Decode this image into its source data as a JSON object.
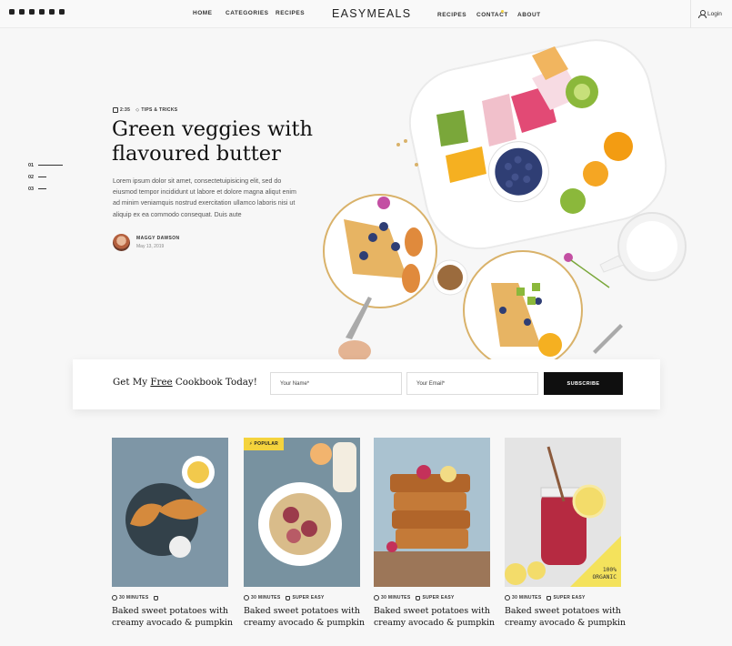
{
  "header": {
    "social_icons": [
      "instagram-icon",
      "twitter-icon",
      "facebook-icon",
      "pinterest-icon",
      "rss-icon",
      "youtube-icon"
    ],
    "nav_left": [
      "HOME",
      "CATEGORIES",
      "RECIPES"
    ],
    "brand": "EASYMEALS",
    "nav_right": [
      "RECIPES",
      "CONTACT",
      "ABOUT"
    ],
    "login": "Login"
  },
  "slides": [
    "01",
    "02",
    "03"
  ],
  "hero": {
    "time": "2:35",
    "category": "TIPS & TRICKS",
    "title": "Green veggies with flavoured butter",
    "description": "Lorem ipsum dolor sit amet, consectetuipisicing elit, sed do eiusmod tempor incididunt ut labore et dolore magna aliqut enim ad minim veniamquis nostrud exercitation ullamco laboris nisi ut aliquip ex ea commodo consequat. Duis aute",
    "author_name": "MAGGY DAWSON",
    "author_date": "May 13, 2019"
  },
  "subscribe": {
    "title_pre": "Get My ",
    "title_free": "Free",
    "title_post": " Cookbook Today!",
    "name_placeholder": "Your Name*",
    "email_placeholder": "Your Email*",
    "button": "SUBSCRIBE"
  },
  "cards": [
    {
      "time": "30 MINUTES",
      "difficulty": "",
      "title": "Baked sweet potatoes with creamy avocado & pumpkin",
      "badge": ""
    },
    {
      "time": "30 MINUTES",
      "difficulty": "SUPER EASY",
      "title": "Baked sweet potatoes with creamy avocado & pumpkin",
      "badge": "POPULAR"
    },
    {
      "time": "30 MINUTES",
      "difficulty": "SUPER EASY",
      "title": "Baked sweet potatoes with creamy avocado & pumpkin",
      "badge": ""
    },
    {
      "time": "30 MINUTES",
      "difficulty": "SUPER EASY",
      "title": "Baked sweet potatoes with creamy avocado & pumpkin",
      "badge": "100% ORGANIC"
    }
  ],
  "organic_line1": "100%",
  "organic_line2": "ORGANIC",
  "colors": {
    "accent": "#f4d33d",
    "button": "#0f0f0f",
    "background": "#f7f7f7"
  }
}
